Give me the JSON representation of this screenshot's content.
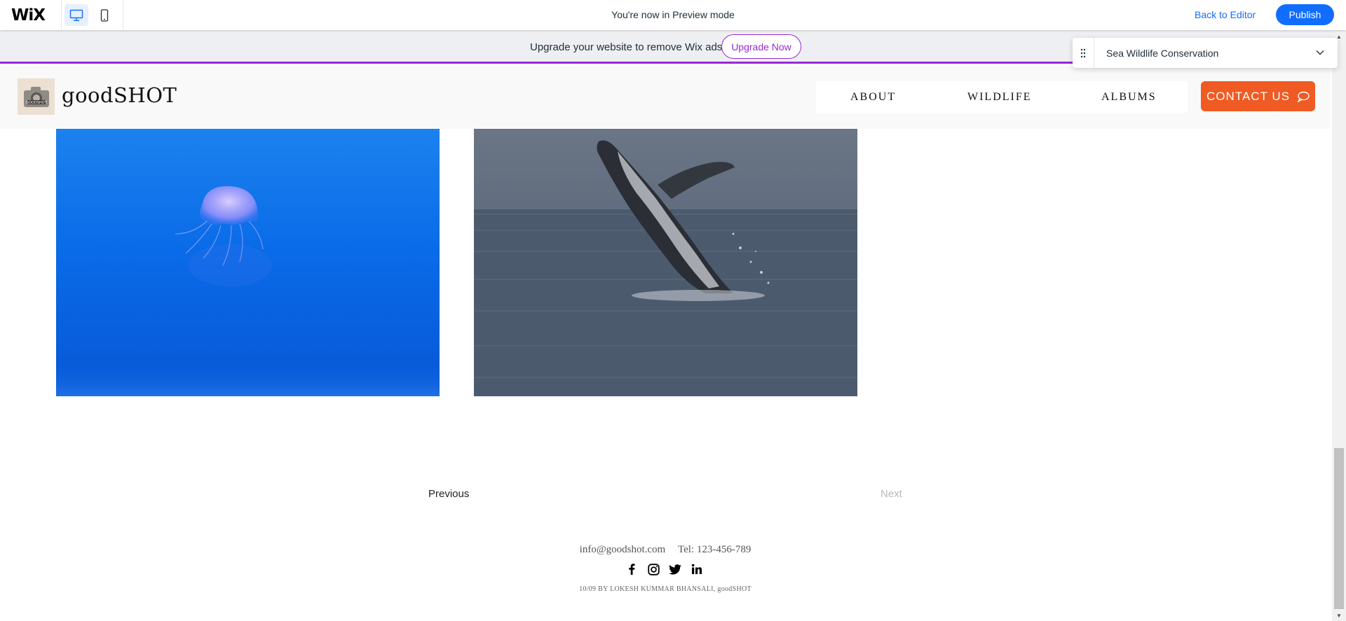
{
  "wix_bar": {
    "logo": "WiX",
    "preview_text": "You're now in Preview mode",
    "back_to_editor": "Back to Editor",
    "publish": "Publish",
    "accent_color": "#116dff"
  },
  "upgrade_banner": {
    "text": "Upgrade your website to remove Wix ads",
    "button": "Upgrade Now",
    "accent_color": "#9a27d5"
  },
  "page_selector": {
    "current_page": "Sea Wildlife Conservation"
  },
  "site": {
    "title": "goodSHOT",
    "logo_icon": "camera-logo",
    "nav": [
      "ABOUT",
      "WILDLIFE",
      "ALBUMS"
    ],
    "contact_button": "CONTACT US",
    "contact_color": "#f05a23"
  },
  "gallery": [
    {
      "name": "jellyfish-photo"
    },
    {
      "name": "whale-photo"
    }
  ],
  "pagination": {
    "previous": "Previous",
    "next": "Next"
  },
  "footer": {
    "email": "info@goodshot.com",
    "phone": "Tel: 123-456-789",
    "social": [
      "facebook-icon",
      "instagram-icon",
      "twitter-icon",
      "linkedin-icon"
    ],
    "copyright": "10/09 BY LOKESH KUMMAR BHANSALI, goodSHOT"
  }
}
